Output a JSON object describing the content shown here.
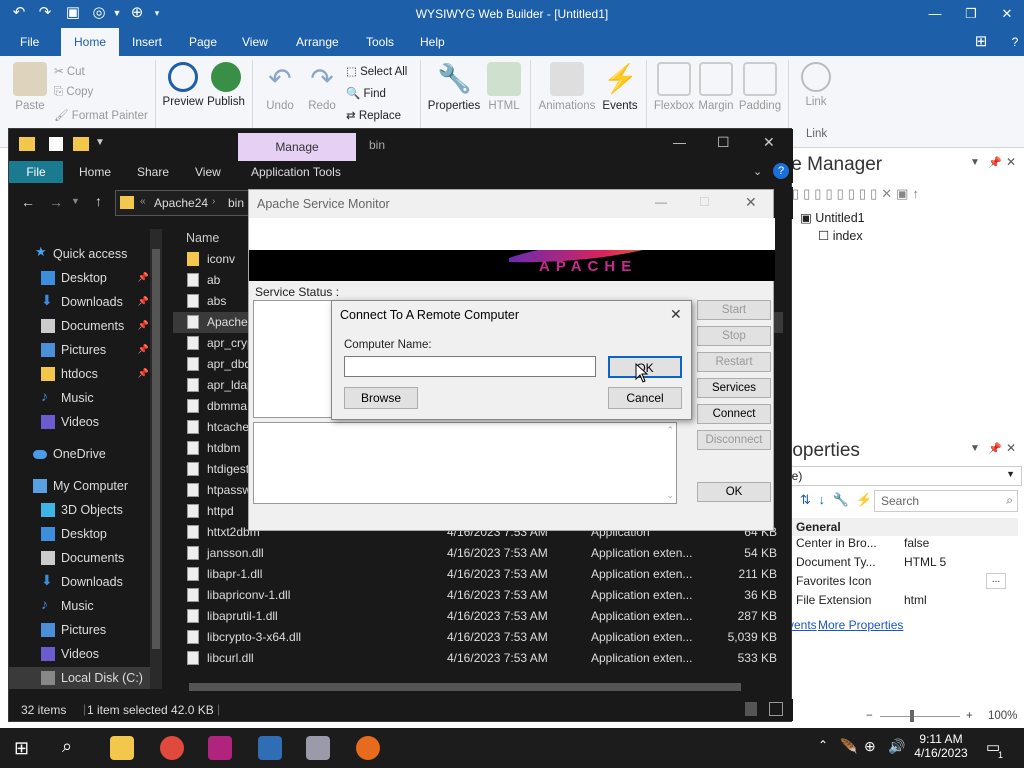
{
  "builder": {
    "title": "WYSIWYG Web Builder - [Untitled1]",
    "menu": [
      "File",
      "Home",
      "Insert",
      "Page",
      "View",
      "Arrange",
      "Tools",
      "Help"
    ],
    "active_menu": "Home",
    "ribbon": {
      "paste": "Paste",
      "cut": "Cut",
      "copy": "Copy",
      "format_painter": "Format Painter",
      "preview": "Preview",
      "publish": "Publish",
      "undo": "Undo",
      "redo": "Redo",
      "select_all": "Select All",
      "find": "Find",
      "replace": "Replace",
      "properties": "Properties",
      "html": "HTML",
      "animations": "Animations",
      "events": "Events",
      "flexbox": "Flexbox",
      "margin": "Margin",
      "padding": "Padding",
      "link": "Link",
      "link_group": "Link"
    }
  },
  "explorer": {
    "manage": "Manage",
    "folder_title": "bin",
    "tabs": [
      "File",
      "Home",
      "Share",
      "View",
      "Application Tools"
    ],
    "path": [
      "Apache24",
      "bin"
    ],
    "column_name": "Name",
    "nav": [
      {
        "label": "Quick access",
        "pin": false
      },
      {
        "label": "Desktop",
        "pin": true
      },
      {
        "label": "Downloads",
        "pin": true
      },
      {
        "label": "Documents",
        "pin": true
      },
      {
        "label": "Pictures",
        "pin": true
      },
      {
        "label": "htdocs",
        "pin": true
      },
      {
        "label": "Music",
        "pin": false
      },
      {
        "label": "Videos",
        "pin": false
      },
      {
        "label": "OneDrive",
        "pin": false
      },
      {
        "label": "My Computer",
        "pin": false
      },
      {
        "label": "3D Objects",
        "pin": false
      },
      {
        "label": "Desktop",
        "pin": false
      },
      {
        "label": "Documents",
        "pin": false
      },
      {
        "label": "Downloads",
        "pin": false
      },
      {
        "label": "Music",
        "pin": false
      },
      {
        "label": "Pictures",
        "pin": false
      },
      {
        "label": "Videos",
        "pin": false
      },
      {
        "label": "Local Disk (C:)",
        "pin": false
      }
    ],
    "files": [
      {
        "name": "iconv",
        "date": "",
        "type": "",
        "size": ""
      },
      {
        "name": "ab",
        "date": "",
        "type": "",
        "size": ""
      },
      {
        "name": "abs",
        "date": "",
        "type": "",
        "size": ""
      },
      {
        "name": "ApacheM",
        "date": "",
        "type": "",
        "size": ""
      },
      {
        "name": "apr_cryp",
        "date": "",
        "type": "",
        "size": ""
      },
      {
        "name": "apr_dbd",
        "date": "",
        "type": "",
        "size": ""
      },
      {
        "name": "apr_ldap",
        "date": "",
        "type": "",
        "size": ""
      },
      {
        "name": "dbmma",
        "date": "",
        "type": "",
        "size": ""
      },
      {
        "name": "htcache",
        "date": "",
        "type": "",
        "size": ""
      },
      {
        "name": "htdbm",
        "date": "",
        "type": "",
        "size": ""
      },
      {
        "name": "htdigest",
        "date": "",
        "type": "",
        "size": ""
      },
      {
        "name": "htpassw",
        "date": "",
        "type": "",
        "size": ""
      },
      {
        "name": "httpd",
        "date": "",
        "type": "",
        "size": ""
      },
      {
        "name": "httxt2dbm",
        "date": "4/16/2023 7:53 AM",
        "type": "Application",
        "size": "64 KB"
      },
      {
        "name": "jansson.dll",
        "date": "4/16/2023 7:53 AM",
        "type": "Application exten...",
        "size": "54 KB"
      },
      {
        "name": "libapr-1.dll",
        "date": "4/16/2023 7:53 AM",
        "type": "Application exten...",
        "size": "211 KB"
      },
      {
        "name": "libapriconv-1.dll",
        "date": "4/16/2023 7:53 AM",
        "type": "Application exten...",
        "size": "36 KB"
      },
      {
        "name": "libaprutil-1.dll",
        "date": "4/16/2023 7:53 AM",
        "type": "Application exten...",
        "size": "287 KB"
      },
      {
        "name": "libcrypto-3-x64.dll",
        "date": "4/16/2023 7:53 AM",
        "type": "Application exten...",
        "size": "5,039 KB"
      },
      {
        "name": "libcurl.dll",
        "date": "4/16/2023 7:53 AM",
        "type": "Application exten...",
        "size": "533 KB"
      }
    ],
    "status_items": "32 items",
    "status_selected": "1 item selected  42.0 KB"
  },
  "apache": {
    "title": "Apache Service Monitor",
    "service_status": "Service Status :",
    "buttons": [
      "Start",
      "Stop",
      "Restart",
      "Services",
      "Connect",
      "Disconnect"
    ],
    "ok": "OK",
    "logo_text": "APACHE"
  },
  "dialog": {
    "title": "Connect To A Remote Computer",
    "label": "Computer Name:",
    "value": "",
    "ok": "OK",
    "browse": "Browse",
    "cancel": "Cancel"
  },
  "site_manager": {
    "title": "te Manager",
    "tree_root": "Untitled1",
    "tree_child": "index"
  },
  "properties": {
    "title": "roperties",
    "dropdown": "ge)",
    "search_placeholder": "Search",
    "section": "General",
    "rows": [
      {
        "name": "Center in Bro...",
        "value": "false"
      },
      {
        "name": "Document Ty...",
        "value": "HTML 5"
      },
      {
        "name": "Favorites Icon",
        "value": ""
      },
      {
        "name": "File Extension",
        "value": "html"
      }
    ],
    "link1": "vents",
    "link2": "More Properties"
  },
  "zoom": "100%",
  "taskbar": {
    "time": "9:11 AM",
    "date": "4/16/2023",
    "notif": "1"
  }
}
